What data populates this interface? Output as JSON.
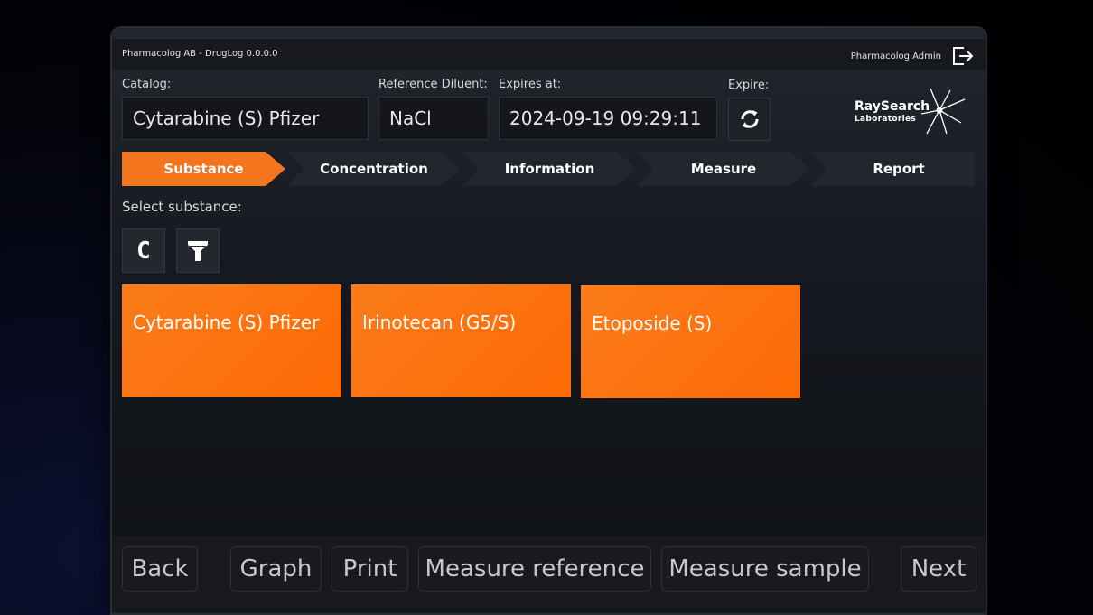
{
  "window": {
    "app_title": "Pharmacolog AB - DrugLog 0.0.0.0",
    "user": "Pharmacolog Admin"
  },
  "header": {
    "catalog_label": "Catalog:",
    "catalog_value": "Cytarabine (S) Pfizer",
    "diluent_label": "Reference Diluent:",
    "diluent_value": "NaCl",
    "expires_label": "Expires at:",
    "expires_value": "2024-09-19 09:29:11",
    "expire_label": "Expire:"
  },
  "logo": {
    "line1": "RaySearch",
    "line2": "Laboratories"
  },
  "steps": [
    {
      "label": "Substance",
      "active": true
    },
    {
      "label": "Concentration",
      "active": false
    },
    {
      "label": "Information",
      "active": false
    },
    {
      "label": "Measure",
      "active": false
    },
    {
      "label": "Report",
      "active": false
    }
  ],
  "main": {
    "select_label": "Select substance:",
    "clear_label": "C",
    "substances": [
      "Cytarabine (S) Pfizer",
      "Irinotecan (G5/S)",
      "Etoposide (S)"
    ]
  },
  "footer": {
    "back": "Back",
    "graph": "Graph",
    "print": "Print",
    "measure_reference": "Measure reference",
    "measure_sample": "Measure sample",
    "next": "Next"
  },
  "colors": {
    "accent": "#f3761f",
    "tile": "#fd6a05",
    "panel": "#17191e"
  }
}
